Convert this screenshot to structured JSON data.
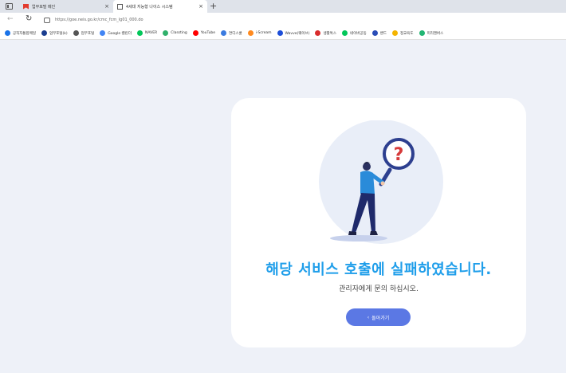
{
  "browser": {
    "tabs": [
      {
        "title": "업무포털 메인",
        "active": false
      },
      {
        "title": "4세대 지능형 나이스 시스템",
        "active": true
      }
    ],
    "new_tab": "+",
    "close_glyph": "×",
    "url": "https://goe.neis.go.kr/cmc_fcm_lg01_000.do",
    "bookmarks": [
      {
        "label": "공직자통합메일",
        "icon": "star-icon",
        "color": "#1a73e8"
      },
      {
        "label": "업무포털(k)",
        "icon": "taeguk-icon",
        "color": "#1a3d8f"
      },
      {
        "label": "업무포털",
        "icon": "building-icon",
        "color": "#555555"
      },
      {
        "label": "Google 캘린더",
        "icon": "calendar-icon",
        "color": "#4285f4"
      },
      {
        "label": "NAVER",
        "icon": "naver-icon",
        "color": "#03c75a"
      },
      {
        "label": "Classting",
        "icon": "classting-icon",
        "color": "#30b06b"
      },
      {
        "label": "YouTube",
        "icon": "youtube-icon",
        "color": "#ff0000"
      },
      {
        "label": "연디스쿨",
        "icon": "globe-icon",
        "color": "#3b7be0"
      },
      {
        "label": "i-Scream",
        "icon": "iscream-icon",
        "color": "#ff8a1f"
      },
      {
        "label": "Wavve(웨이브)",
        "icon": "wavve-icon",
        "color": "#1d4ed8"
      },
      {
        "label": "생활톡스",
        "icon": "bookmark-red-icon",
        "color": "#d92d2d"
      },
      {
        "label": "네이버공동",
        "icon": "naver-icon",
        "color": "#03c75a"
      },
      {
        "label": "밴드",
        "icon": "band-icon",
        "color": "#2a4db7"
      },
      {
        "label": "정교육도",
        "icon": "pencil-icon",
        "color": "#f4b400"
      },
      {
        "label": "미리캔버스",
        "icon": "canvas-icon",
        "color": "#22b573"
      }
    ]
  },
  "error": {
    "headline": "해당 서비스 호출에 실패하였습니다.",
    "message": "관리자에게 문의 하십시오.",
    "back_label": "돌아가기",
    "back_arrow": "‹",
    "question_mark": "?"
  },
  "colors": {
    "headline": "#1f9eea",
    "button": "#5b78e4",
    "background": "#eef1f8",
    "question": "#d63a3a"
  }
}
